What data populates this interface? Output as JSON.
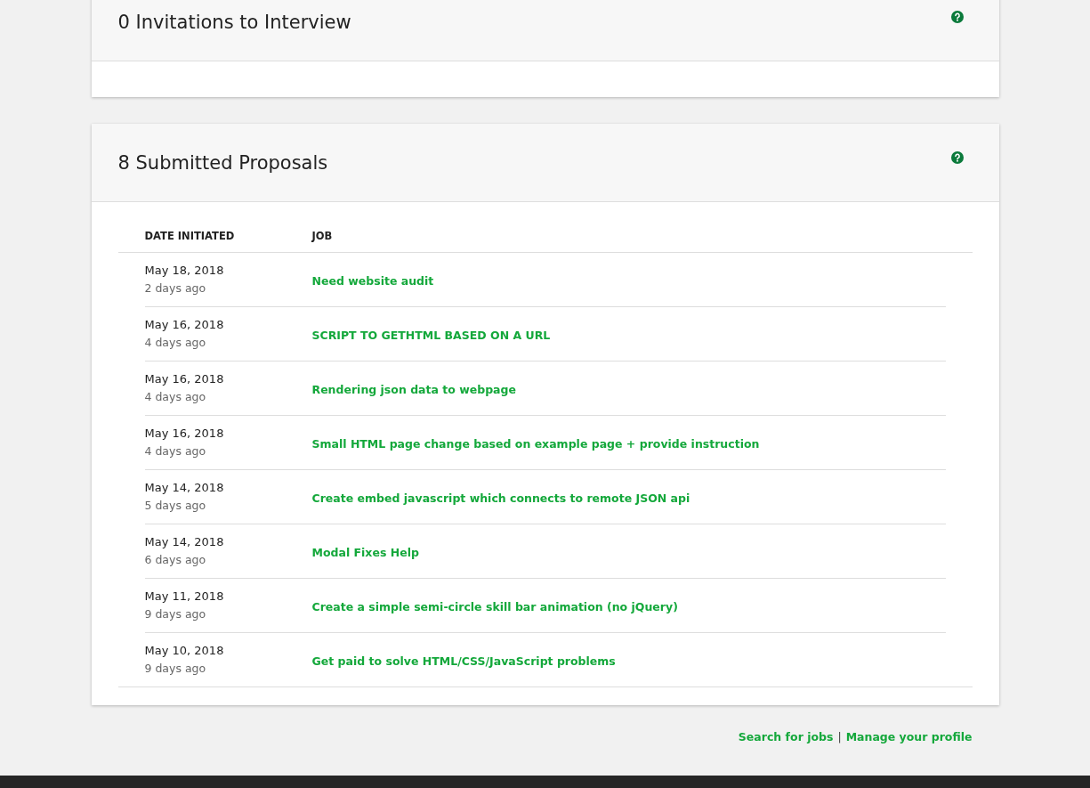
{
  "sections": [
    {
      "title": "0 Invitations to Interview"
    },
    {
      "title": "8 Submitted Proposals",
      "table": {
        "columns": [
          "DATE INITIATED",
          "JOB"
        ],
        "rows": [
          {
            "date": "May 18, 2018",
            "ago": "2 days ago",
            "job": "Need website audit"
          },
          {
            "date": "May 16, 2018",
            "ago": "4 days ago",
            "job": "SCRIPT TO GETHTML BASED ON A URL"
          },
          {
            "date": "May 16, 2018",
            "ago": "4 days ago",
            "job": "Rendering json data to webpage"
          },
          {
            "date": "May 16, 2018",
            "ago": "4 days ago",
            "job": "Small HTML page change based on example page + provide instruction"
          },
          {
            "date": "May 14, 2018",
            "ago": "5 days ago",
            "job": "Create embed javascript which connects to remote JSON api"
          },
          {
            "date": "May 14, 2018",
            "ago": "6 days ago",
            "job": "Modal Fixes Help"
          },
          {
            "date": "May 11, 2018",
            "ago": "9 days ago",
            "job": "Create a simple semi-circle skill bar animation (no jQuery)"
          },
          {
            "date": "May 10, 2018",
            "ago": "9 days ago",
            "job": "Get paid to solve HTML/CSS/JavaScript problems"
          }
        ]
      }
    }
  ],
  "footer_links": [
    {
      "label": "Search for jobs"
    },
    {
      "label": "Manage your profile"
    }
  ],
  "footer_separator": "|"
}
